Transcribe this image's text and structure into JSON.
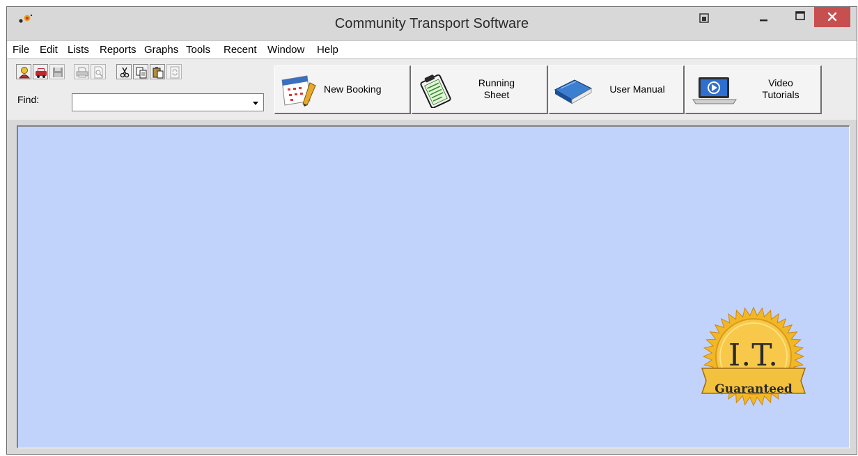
{
  "window": {
    "title": "Community Transport Software"
  },
  "menu": {
    "items": [
      "File",
      "Edit",
      "Lists",
      "Reports",
      "Graphs",
      "Tools",
      "Recent",
      "Window",
      "Help"
    ]
  },
  "toolbar": {
    "small_icons": [
      "client-icon",
      "vehicle-icon",
      "save-icon",
      "print-icon",
      "print-preview-icon",
      "cut-icon",
      "copy-icon",
      "paste-icon",
      "refresh-icon"
    ],
    "find_label": "Find:",
    "find_value": "",
    "big_buttons": [
      {
        "icon": "calendar-icon",
        "label": "New Booking"
      },
      {
        "icon": "clipboard-icon",
        "label_line1": "Running",
        "label_line2": "Sheet"
      },
      {
        "icon": "book-icon",
        "label": "User Manual"
      },
      {
        "icon": "video-laptop-icon",
        "label_line1": "Video",
        "label_line2": "Tutorials"
      }
    ]
  },
  "seal": {
    "line1": "I.T.",
    "line2": "Guaranteed"
  },
  "colors": {
    "client_background": "#c2d3fb",
    "close_button": "#c74f4f",
    "seal_gold": "#f2b724"
  }
}
